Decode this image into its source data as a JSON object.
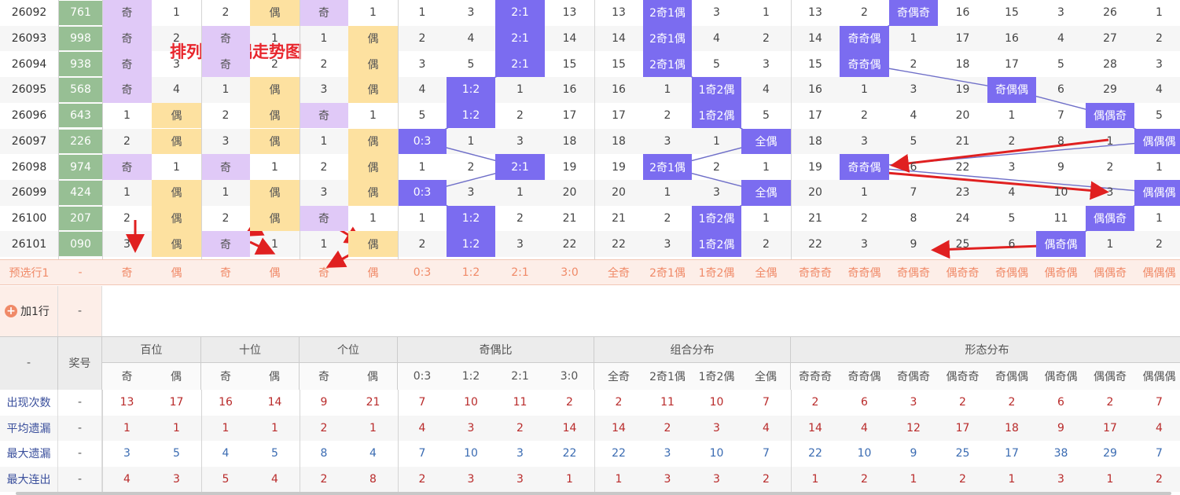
{
  "title_annotation": "排列三奇偶走势图",
  "colors": {
    "purple": "#7b6cf0",
    "light_purple": "#e0c9f7",
    "light_orange": "#fde1a0",
    "green": "#97bf94",
    "preselect_bg": "#fdeee8",
    "preselect_text": "#f08a68",
    "stat_label": "#3a4f9c",
    "red_text": "#b92b2b",
    "blue_text": "#3a6bb2",
    "arrow_red": "#e02020"
  },
  "rows": [
    {
      "issue": "26092",
      "num": "761",
      "cells": [
        "奇",
        "1",
        "2",
        "偶",
        "奇",
        "1",
        "1",
        "3",
        "2:1",
        "13",
        "13",
        "2奇1偶",
        "3",
        "1",
        "13",
        "2",
        "奇偶奇",
        "16",
        "15",
        "3",
        "26",
        "1"
      ]
    },
    {
      "issue": "26093",
      "num": "998",
      "cells": [
        "奇",
        "2",
        "奇",
        "1",
        "1",
        "偶",
        "2",
        "4",
        "2:1",
        "14",
        "14",
        "2奇1偶",
        "4",
        "2",
        "14",
        "奇奇偶",
        "1",
        "17",
        "16",
        "4",
        "27",
        "2"
      ]
    },
    {
      "issue": "26094",
      "num": "938",
      "cells": [
        "奇",
        "3",
        "奇",
        "2",
        "2",
        "偶",
        "3",
        "5",
        "2:1",
        "15",
        "15",
        "2奇1偶",
        "5",
        "3",
        "15",
        "奇奇偶",
        "2",
        "18",
        "17",
        "5",
        "28",
        "3"
      ]
    },
    {
      "issue": "26095",
      "num": "568",
      "cells": [
        "奇",
        "4",
        "1",
        "偶",
        "3",
        "偶",
        "4",
        "1:2",
        "1",
        "16",
        "16",
        "1",
        "1奇2偶",
        "4",
        "16",
        "1",
        "3",
        "19",
        "奇偶偶",
        "6",
        "29",
        "4"
      ]
    },
    {
      "issue": "26096",
      "num": "643",
      "cells": [
        "1",
        "偶",
        "2",
        "偶",
        "奇",
        "1",
        "5",
        "1:2",
        "2",
        "17",
        "17",
        "2",
        "1奇2偶",
        "5",
        "17",
        "2",
        "4",
        "20",
        "1",
        "7",
        "偶偶奇",
        "5"
      ]
    },
    {
      "issue": "26097",
      "num": "226",
      "cells": [
        "2",
        "偶",
        "3",
        "偶",
        "1",
        "偶",
        "0:3",
        "1",
        "3",
        "18",
        "18",
        "3",
        "1",
        "全偶",
        "18",
        "3",
        "5",
        "21",
        "2",
        "8",
        "1",
        "偶偶偶"
      ]
    },
    {
      "issue": "26098",
      "num": "974",
      "cells": [
        "奇",
        "1",
        "奇",
        "1",
        "2",
        "偶",
        "1",
        "2",
        "2:1",
        "19",
        "19",
        "2奇1偶",
        "2",
        "1",
        "19",
        "奇奇偶",
        "6",
        "22",
        "3",
        "9",
        "2",
        "1"
      ]
    },
    {
      "issue": "26099",
      "num": "424",
      "cells": [
        "1",
        "偶",
        "1",
        "偶",
        "3",
        "偶",
        "0:3",
        "3",
        "1",
        "20",
        "20",
        "1",
        "3",
        "全偶",
        "20",
        "1",
        "7",
        "23",
        "4",
        "10",
        "3",
        "偶偶偶"
      ]
    },
    {
      "issue": "26100",
      "num": "207",
      "cells": [
        "2",
        "偶",
        "2",
        "偶",
        "奇",
        "1",
        "1",
        "1:2",
        "2",
        "21",
        "21",
        "2",
        "1奇2偶",
        "1",
        "21",
        "2",
        "8",
        "24",
        "5",
        "11",
        "偶偶奇",
        "1"
      ]
    },
    {
      "issue": "26101",
      "num": "090",
      "cells": [
        "3",
        "偶",
        "奇",
        "1",
        "1",
        "偶",
        "2",
        "1:2",
        "3",
        "22",
        "22",
        "3",
        "1奇2偶",
        "2",
        "22",
        "3",
        "9",
        "25",
        "6",
        "偶奇偶",
        "1",
        "2"
      ]
    }
  ],
  "preselect": {
    "label": "预选行1",
    "num": "-",
    "cells": [
      "奇",
      "偶",
      "奇",
      "偶",
      "奇",
      "偶",
      "0:3",
      "1:2",
      "2:1",
      "3:0",
      "全奇",
      "2奇1偶",
      "1奇2偶",
      "全偶",
      "奇奇奇",
      "奇奇偶",
      "奇偶奇",
      "偶奇奇",
      "奇偶偶",
      "偶奇偶",
      "偶偶奇",
      "偶偶偶"
    ]
  },
  "add_row": {
    "label": "加1行",
    "num": "-"
  },
  "header": {
    "corner": "-",
    "num_label": "奖号",
    "groups": [
      "百位",
      "十位",
      "个位",
      "奇偶比",
      "组合分布",
      "形态分布"
    ],
    "subs": [
      "奇",
      "偶",
      "奇",
      "偶",
      "奇",
      "偶",
      "0:3",
      "1:2",
      "2:1",
      "3:0",
      "全奇",
      "2奇1偶",
      "1奇2偶",
      "全偶",
      "奇奇奇",
      "奇奇偶",
      "奇偶奇",
      "偶奇奇",
      "奇偶偶",
      "偶奇偶",
      "偶偶奇",
      "偶偶偶"
    ]
  },
  "stats": [
    {
      "label": "出现次数",
      "num": "-",
      "values": [
        "13",
        "17",
        "16",
        "14",
        "9",
        "21",
        "7",
        "10",
        "11",
        "2",
        "2",
        "11",
        "10",
        "7",
        "2",
        "6",
        "3",
        "2",
        "2",
        "6",
        "2",
        "7"
      ]
    },
    {
      "label": "平均遗漏",
      "num": "-",
      "values": [
        "1",
        "1",
        "1",
        "1",
        "2",
        "1",
        "4",
        "3",
        "2",
        "14",
        "14",
        "2",
        "3",
        "4",
        "14",
        "4",
        "12",
        "17",
        "18",
        "9",
        "17",
        "4"
      ]
    },
    {
      "label": "最大遗漏",
      "num": "-",
      "values": [
        "3",
        "5",
        "4",
        "5",
        "8",
        "4",
        "7",
        "10",
        "3",
        "22",
        "22",
        "3",
        "10",
        "7",
        "22",
        "10",
        "9",
        "25",
        "17",
        "38",
        "29",
        "7"
      ]
    },
    {
      "label": "最大连出",
      "num": "-",
      "values": [
        "4",
        "3",
        "5",
        "4",
        "2",
        "8",
        "2",
        "3",
        "3",
        "1",
        "1",
        "3",
        "3",
        "2",
        "1",
        "2",
        "1",
        "2",
        "1",
        "3",
        "1",
        "2"
      ]
    }
  ]
}
